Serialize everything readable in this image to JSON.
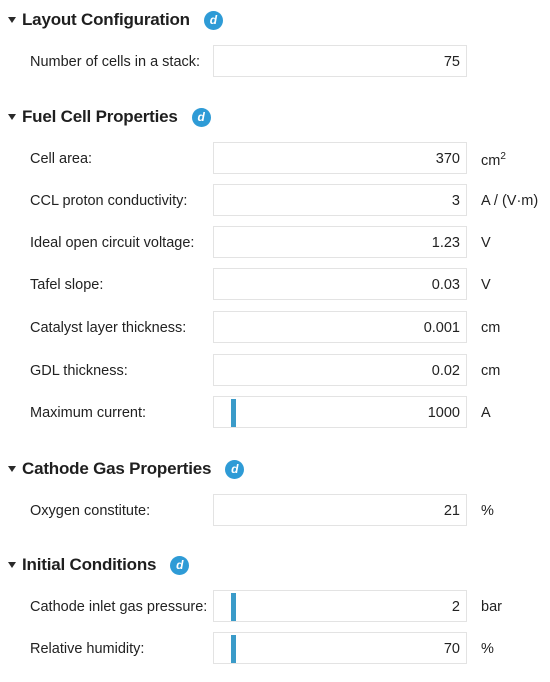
{
  "sections": [
    {
      "title": "Layout Configuration",
      "badge": "d",
      "rows": [
        {
          "label": "Number of cells in a stack:",
          "value": "75",
          "unit": ""
        }
      ]
    },
    {
      "title": "Fuel Cell Properties",
      "badge": "d",
      "rows": [
        {
          "label": "Cell area:",
          "value": "370",
          "unit": "cm",
          "unit_sup": "2"
        },
        {
          "label": "CCL proton conductivity:",
          "value": "3",
          "unit": "A / (V·m)"
        },
        {
          "label": "Ideal open circuit voltage:",
          "value": "1.23",
          "unit": "V"
        },
        {
          "label": "Tafel slope:",
          "value": "0.03",
          "unit": "V"
        },
        {
          "label": "Catalyst layer thickness:",
          "value": "0.001",
          "unit": "cm"
        },
        {
          "label": "GDL thickness:",
          "value": "0.02",
          "unit": "cm"
        },
        {
          "label": "Maximum current:",
          "value": "1000",
          "unit": "A",
          "slider": true
        }
      ]
    },
    {
      "title": "Cathode Gas Properties",
      "badge": "d",
      "rows": [
        {
          "label": "Oxygen constitute:",
          "value": "21",
          "unit": "%"
        }
      ]
    },
    {
      "title": "Initial Conditions",
      "badge": "d",
      "rows": [
        {
          "label": "Cathode inlet gas pressure:",
          "value": "2",
          "unit": "bar",
          "slider": true
        },
        {
          "label": "Relative humidity:",
          "value": "70",
          "unit": "%",
          "slider": true
        }
      ]
    }
  ],
  "colors": {
    "badge": "#2e9bd6",
    "slider_marker": "#3a9bc9",
    "field_border": "#e3e3e3"
  }
}
